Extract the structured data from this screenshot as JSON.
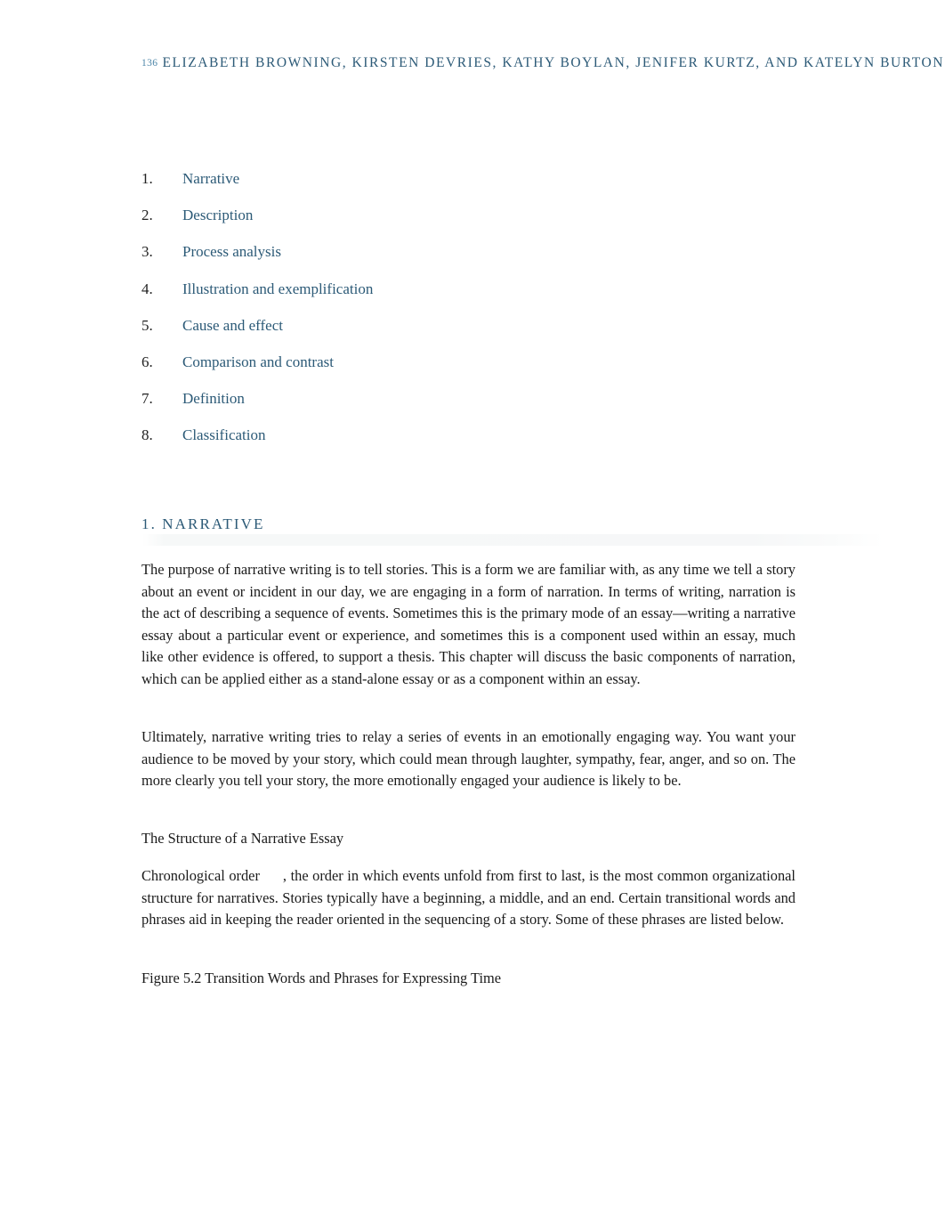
{
  "header": {
    "folio": "136",
    "authors": "ELIZABETH BROWNING, KIRSTEN DEVRIES, KATHY BOYLAN, JENIFER KURTZ, AND KATELYN BURTON"
  },
  "mode_list": [
    {
      "number": "1.",
      "label": "Narrative"
    },
    {
      "number": "2.",
      "label": "Description"
    },
    {
      "number": "3.",
      "label": "Process analysis"
    },
    {
      "number": "4.",
      "label": "Illustration and exemplification"
    },
    {
      "number": "5.",
      "label": "Cause and effect"
    },
    {
      "number": "6.",
      "label": "Comparison and contrast"
    },
    {
      "number": "7.",
      "label": "Definition"
    },
    {
      "number": "8.",
      "label": "Classification"
    }
  ],
  "section": {
    "heading": "1.  NARRATIVE"
  },
  "paragraphs": {
    "p1": "The purpose of narrative writing is to tell stories. This is a form we are familiar with, as any time we tell a story about an event or incident in our day, we are engaging in a form of narration. In terms of writing, narration is the act of describing a sequence of events. Sometimes this is the primary mode of an essay—writing a narrative essay about a particular event or experience, and sometimes this is a component used within an essay, much like other evidence is offered, to support a thesis. This chapter will discuss the basic components of narration, which can be applied either as a stand-alone essay or as a component within an essay.",
    "p2": "Ultimately, narrative writing tries to relay a series of events in an emotionally engaging way. You want your audience to be moved by your story, which could mean through laughter, sympathy, fear, anger, and so on. The more clearly you tell your story, the more emotionally engaged your audience is likely to be.",
    "p3": "The Structure of a Narrative Essay",
    "p4_term": "Chronological order",
    "p4_rest": ", the order in which events unfold from first to last, is the most common organizational structure for narratives. Stories typically have a beginning, a middle, and an end. Certain transitional words and phrases aid in keeping the reader oriented in the sequencing of a story. Some of these phrases are listed below.",
    "p5": "Figure 5.2 Transition Words and Phrases for Expressing Time"
  },
  "colors": {
    "link_blue": "#2c5a77",
    "folio_blue": "#4d86a8",
    "body_text": "#1a1a1a",
    "rule_gray": "#f6f7f8",
    "page_background": "#ffffff"
  }
}
